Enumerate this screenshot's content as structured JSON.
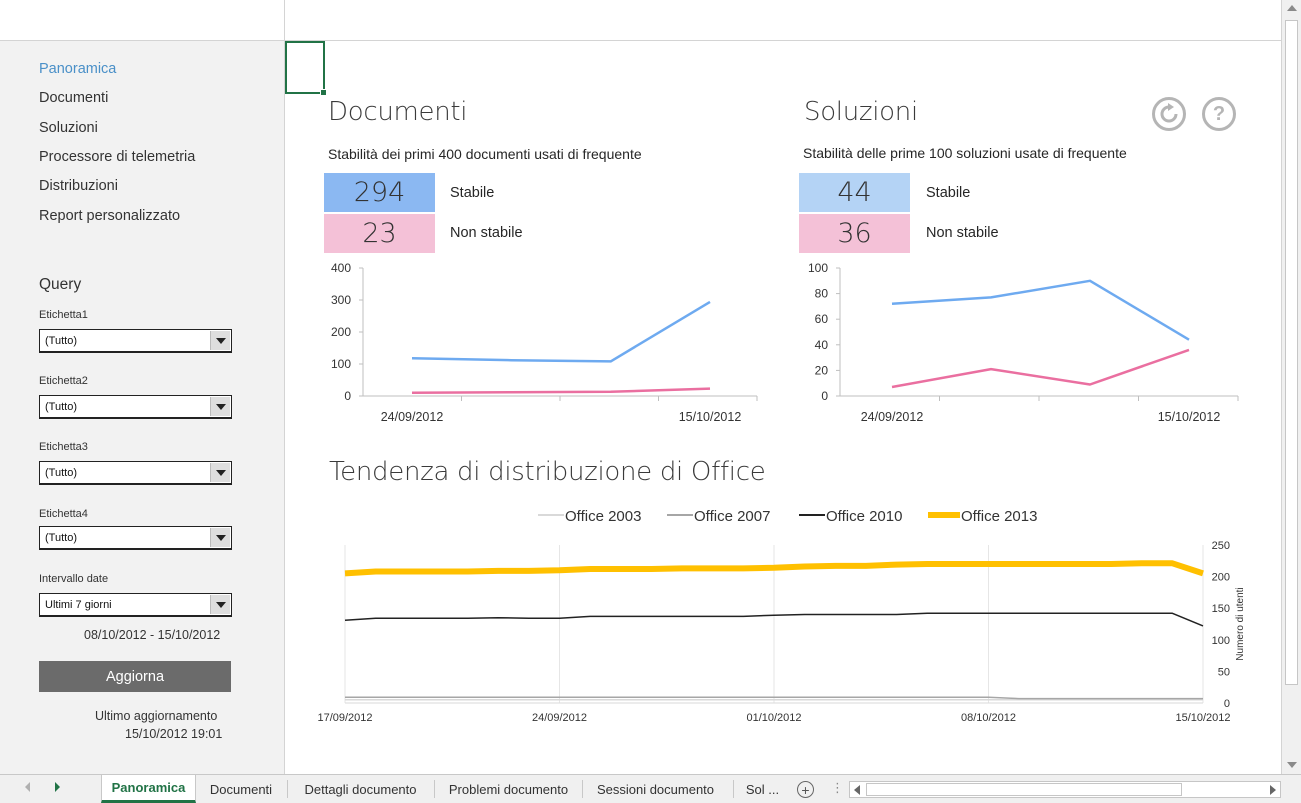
{
  "sidebar": {
    "nav": [
      {
        "label": "Panoramica",
        "active": true
      },
      {
        "label": "Documenti"
      },
      {
        "label": "Soluzioni"
      },
      {
        "label": "Processore di telemetria"
      },
      {
        "label": "Distribuzioni"
      },
      {
        "label": "Report personalizzato"
      }
    ],
    "query_title": "Query",
    "filters": [
      {
        "label": "Etichetta1",
        "value": "(Tutto)"
      },
      {
        "label": "Etichetta2",
        "value": "(Tutto)"
      },
      {
        "label": "Etichetta3",
        "value": "(Tutto)"
      },
      {
        "label": "Etichetta4",
        "value": "(Tutto)"
      },
      {
        "label": "Intervallo date",
        "value": "Ultimi 7 giorni"
      }
    ],
    "date_range": "08/10/2012 - 15/10/2012",
    "refresh_label": "Aggiorna",
    "last_update_label": "Ultimo aggiornamento",
    "last_update_value": "15/10/2012 19:01"
  },
  "documents": {
    "title": "Documenti",
    "subtitle": "Stabilità dei primi 400 documenti usati di frequente",
    "stable_value": "294",
    "stable_label": "Stabile",
    "unstable_value": "23",
    "unstable_label": "Non stabile"
  },
  "solutions": {
    "title": "Soluzioni",
    "subtitle": "Stabilità delle prime 100 soluzioni usate di frequente",
    "stable_value": "44",
    "stable_label": "Stabile",
    "unstable_value": "36",
    "unstable_label": "Non stabile"
  },
  "icons": {
    "refresh": "refresh-icon",
    "help": "help-icon",
    "help_glyph": "?"
  },
  "colors": {
    "stable": "#6eaaf0",
    "stable_kpi_docs": "#8bb8f2",
    "stable_kpi_sol": "#b4d3f5",
    "unstable": "#ea6fa0",
    "unstable_kpi": "#f4c1d7",
    "office2003": "#d9d9d9",
    "office2007": "#a6a6a6",
    "office2010": "#222222",
    "office2013": "#ffc000",
    "accent": "#217346"
  },
  "trend_title": "Tendenza di distribuzione di Office",
  "chart_data": [
    {
      "type": "line",
      "name": "documents-stability",
      "x_labels": [
        "24/09/2012",
        "15/10/2012"
      ],
      "ylim": [
        0,
        400
      ],
      "yticks": [
        0,
        100,
        200,
        300,
        400
      ],
      "series": [
        {
          "name": "Stabile",
          "color": "#6eaaf0",
          "values": [
            118,
            112,
            108,
            294
          ]
        },
        {
          "name": "Non stabile",
          "color": "#ea6fa0",
          "values": [
            10,
            12,
            13,
            23
          ]
        }
      ]
    },
    {
      "type": "line",
      "name": "solutions-stability",
      "x_labels": [
        "24/09/2012",
        "15/10/2012"
      ],
      "ylim": [
        0,
        100
      ],
      "yticks": [
        0,
        20,
        40,
        60,
        80,
        100
      ],
      "series": [
        {
          "name": "Stabile",
          "color": "#6eaaf0",
          "values": [
            72,
            77,
            90,
            44
          ]
        },
        {
          "name": "Non stabile",
          "color": "#ea6fa0",
          "values": [
            7,
            21,
            9,
            36
          ]
        }
      ]
    },
    {
      "type": "line",
      "name": "office-deployment-trend",
      "title": "Tendenza di distribuzione di Office",
      "ylabel": "Numero di utenti",
      "ylim": [
        0,
        250
      ],
      "yticks": [
        0,
        50,
        100,
        150,
        200,
        250
      ],
      "x_labels": [
        "17/09/2012",
        "24/09/2012",
        "01/10/2012",
        "08/10/2012",
        "15/10/2012"
      ],
      "legend": "top",
      "series": [
        {
          "name": "Office 2003",
          "color": "#d9d9d9",
          "width": 1.5,
          "values": [
            5,
            5,
            5,
            5,
            5,
            5,
            5,
            5,
            5,
            5,
            5,
            5,
            5,
            5,
            5,
            5,
            5,
            5,
            5,
            5,
            5,
            5,
            5,
            5,
            5,
            5,
            5,
            5,
            5
          ]
        },
        {
          "name": "Office 2007",
          "color": "#a6a6a6",
          "width": 1.5,
          "values": [
            9,
            9,
            9,
            9,
            9,
            9,
            9,
            9,
            9,
            9,
            9,
            9,
            9,
            9,
            9,
            9,
            9,
            9,
            9,
            9,
            9,
            9,
            7,
            7,
            7,
            7,
            7,
            7,
            7
          ]
        },
        {
          "name": "Office 2010",
          "color": "#222222",
          "width": 1.5,
          "values": [
            131,
            134,
            134,
            134,
            134,
            135,
            134,
            134,
            137,
            137,
            137,
            137,
            137,
            137,
            139,
            140,
            140,
            140,
            140,
            142,
            142,
            142,
            142,
            142,
            142,
            142,
            142,
            142,
            122
          ]
        },
        {
          "name": "Office 2013",
          "color": "#ffc000",
          "width": 6,
          "values": [
            205,
            208,
            208,
            208,
            208,
            209,
            209,
            210,
            212,
            212,
            212,
            213,
            213,
            213,
            214,
            216,
            217,
            217,
            219,
            220,
            220,
            220,
            220,
            220,
            220,
            220,
            221,
            221,
            205
          ]
        }
      ]
    }
  ],
  "tabs": {
    "items": [
      {
        "label": "Panoramica",
        "active": true
      },
      {
        "label": "Documenti"
      },
      {
        "label": "Dettagli documento"
      },
      {
        "label": "Problemi documento"
      },
      {
        "label": "Sessioni documento"
      },
      {
        "label": "Sol ..."
      }
    ],
    "add_glyph": "+",
    "more_glyph": "⋮"
  }
}
